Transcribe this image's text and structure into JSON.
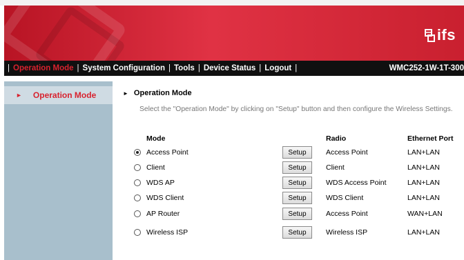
{
  "brand": {
    "logo_text": "ifs",
    "accent": "#d8222e"
  },
  "nav": {
    "items": [
      "Operation Mode",
      "System Configuration",
      "Tools",
      "Device Status",
      "Logout"
    ],
    "model": "WMC252-1W-1T-300"
  },
  "sidebar": {
    "items": [
      {
        "label": "Operation Mode",
        "selected": true
      }
    ]
  },
  "main": {
    "title": "Operation Mode",
    "description": "Select the \"Operation Mode\" by clicking on \"Setup\" button and then configure the Wireless Settings.",
    "headers": {
      "mode": "Mode",
      "radio": "Radio",
      "ethernet": "Ethernet Port"
    },
    "setup_label": "Setup",
    "rows": [
      {
        "mode": "Access Point",
        "radio": "Access Point",
        "ethernet": "LAN+LAN",
        "selected": true
      },
      {
        "mode": "Client",
        "radio": "Client",
        "ethernet": "LAN+LAN",
        "selected": false
      },
      {
        "mode": "WDS AP",
        "radio": "WDS Access Point",
        "ethernet": "LAN+LAN",
        "selected": false
      },
      {
        "mode": "WDS Client",
        "radio": "WDS Client",
        "ethernet": "LAN+LAN",
        "selected": false
      },
      {
        "mode": "AP Router",
        "radio": "Access Point",
        "ethernet": "WAN+LAN",
        "selected": false
      },
      {
        "mode": "Wireless ISP",
        "radio": "Wireless ISP",
        "ethernet": "LAN+LAN",
        "selected": false
      }
    ]
  }
}
